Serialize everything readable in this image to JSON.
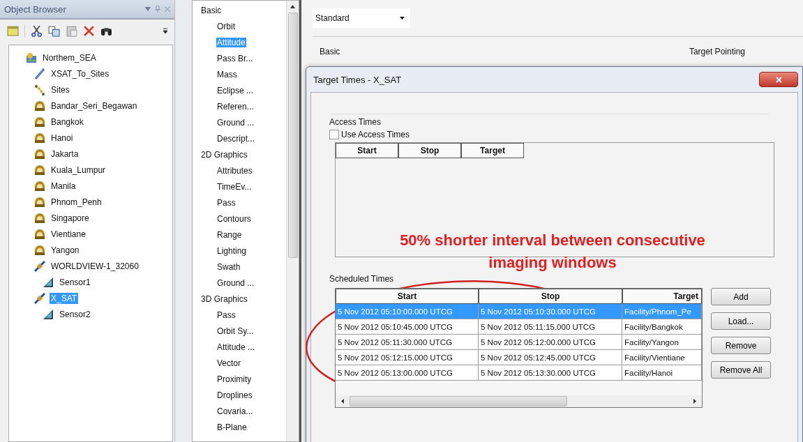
{
  "object_browser": {
    "title": "Object Browser",
    "tree": [
      {
        "label": "Northem_SEA",
        "kind": "scenario",
        "selected": false,
        "children": [
          {
            "label": "XSAT_To_Sites",
            "kind": "chain",
            "selected": false
          },
          {
            "label": "Sites",
            "kind": "constellation",
            "selected": false
          },
          {
            "label": "Bandar_Seri_Begawan",
            "kind": "facility",
            "selected": false
          },
          {
            "label": "Bangkok",
            "kind": "facility",
            "selected": false
          },
          {
            "label": "Hanoi",
            "kind": "facility",
            "selected": false
          },
          {
            "label": "Jakarta",
            "kind": "facility",
            "selected": false
          },
          {
            "label": "Kuala_Lumpur",
            "kind": "facility",
            "selected": false
          },
          {
            "label": "Manila",
            "kind": "facility",
            "selected": false
          },
          {
            "label": "Phnom_Penh",
            "kind": "facility",
            "selected": false
          },
          {
            "label": "Singapore",
            "kind": "facility",
            "selected": false
          },
          {
            "label": "Vientiane",
            "kind": "facility",
            "selected": false
          },
          {
            "label": "Yangon",
            "kind": "facility",
            "selected": false
          },
          {
            "label": "WORLDVIEW-1_32060",
            "kind": "satellite",
            "selected": false,
            "children": [
              {
                "label": "Sensor1",
                "kind": "sensor",
                "selected": false
              }
            ]
          },
          {
            "label": "X_SAT",
            "kind": "satellite",
            "selected": true,
            "children": [
              {
                "label": "Sensor2",
                "kind": "sensor",
                "selected": false
              }
            ]
          }
        ]
      }
    ]
  },
  "properties_tree": {
    "groups": [
      {
        "label": "Basic",
        "items": [
          {
            "label": "Orbit",
            "selected": false
          },
          {
            "label": "Attitude",
            "selected": true
          },
          {
            "label": "Pass Br...",
            "selected": false
          },
          {
            "label": "Mass",
            "selected": false
          },
          {
            "label": "Eclipse ...",
            "selected": false
          },
          {
            "label": "Referen...",
            "selected": false
          },
          {
            "label": "Ground ...",
            "selected": false
          },
          {
            "label": "Descript...",
            "selected": false
          }
        ]
      },
      {
        "label": "2D Graphics",
        "items": [
          {
            "label": "Attributes",
            "selected": false
          },
          {
            "label": "TimeEv...",
            "selected": false
          },
          {
            "label": "Pass",
            "selected": false
          },
          {
            "label": "Contours",
            "selected": false
          },
          {
            "label": "Range",
            "selected": false
          },
          {
            "label": "Lighting",
            "selected": false
          },
          {
            "label": "Swath",
            "selected": false
          },
          {
            "label": "Ground ...",
            "selected": false
          }
        ]
      },
      {
        "label": "3D Graphics",
        "items": [
          {
            "label": "Pass",
            "selected": false
          },
          {
            "label": "Orbit Sy...",
            "selected": false
          },
          {
            "label": "Attitude ...",
            "selected": false
          },
          {
            "label": "Vector",
            "selected": false
          },
          {
            "label": "Proximity",
            "selected": false
          },
          {
            "label": "Droplines",
            "selected": false
          },
          {
            "label": "Covaria...",
            "selected": false
          },
          {
            "label": "B-Plane",
            "selected": false
          }
        ]
      }
    ]
  },
  "style_dropdown": {
    "value": "Standard"
  },
  "section_labels": [
    "Basic",
    "Target Pointing"
  ],
  "dialog": {
    "title": "Target Times - X_SAT",
    "access_times": {
      "title": "Access Times",
      "use_access_times": {
        "label": "Use Access Times",
        "checked": false
      },
      "columns": [
        "Start",
        "Stop",
        "Target"
      ]
    },
    "scheduled_times": {
      "title": "Scheduled Times",
      "columns": [
        "Start",
        "Stop",
        "Target"
      ],
      "rows": [
        {
          "cells": [
            "5 Nov 2012 05:10:00.000 UTCG",
            "5 Nov 2012 05:10:30.000 UTCG",
            "Facility/Phnom_Pe"
          ],
          "selected": true
        },
        {
          "cells": [
            "5 Nov 2012 05:10:45.000 UTCG",
            "5 Nov 2012 05:11:15.000 UTCG",
            "Facility/Bangkok"
          ],
          "selected": false
        },
        {
          "cells": [
            "5 Nov 2012 05:11:30.000 UTCG",
            "5 Nov 2012 05:12:00.000 UTCG",
            "Facility/Yangon"
          ],
          "selected": false
        },
        {
          "cells": [
            "5 Nov 2012 05:12:15.000 UTCG",
            "5 Nov 2012 05:12:45.000 UTCG",
            "Facility/Vientiane"
          ],
          "selected": false
        },
        {
          "cells": [
            "5 Nov 2012 05:13:00.000 UTCG",
            "5 Nov 2012 05:13:30.000 UTCG",
            "Facility/Hanoi"
          ],
          "selected": false
        }
      ]
    },
    "buttons": [
      "Add",
      "Load...",
      "Remove",
      "Remove All"
    ]
  },
  "annotation": {
    "lines": [
      "50% shorter interval between consecutive",
      "imaging windows"
    ]
  }
}
